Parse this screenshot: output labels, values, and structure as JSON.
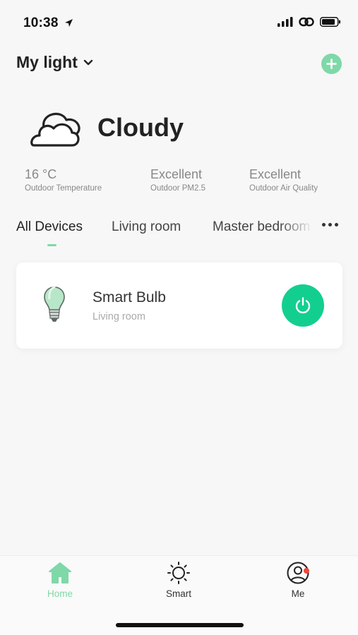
{
  "status_bar": {
    "time": "10:38"
  },
  "header": {
    "home_name": "My light"
  },
  "weather": {
    "condition": "Cloudy",
    "metrics": [
      {
        "value": "16 °C",
        "label": "Outdoor Temperature"
      },
      {
        "value": "Excellent",
        "label": "Outdoor PM2.5"
      },
      {
        "value": "Excellent",
        "label": "Outdoor Air Quality"
      }
    ]
  },
  "tabs": [
    {
      "label": "All Devices",
      "active": true
    },
    {
      "label": "Living room",
      "active": false
    },
    {
      "label": "Master bedroom",
      "active": false
    }
  ],
  "devices": [
    {
      "name": "Smart Bulb",
      "room": "Living room",
      "power": "on"
    }
  ],
  "bottom_nav": [
    {
      "label": "Home",
      "icon": "home-icon",
      "active": true
    },
    {
      "label": "Smart",
      "icon": "sun-icon",
      "active": false
    },
    {
      "label": "Me",
      "icon": "user-icon",
      "active": false,
      "has_notification": true
    }
  ],
  "colors": {
    "accent": "#7fd8a8",
    "power_on": "#13cf8f",
    "notification": "#f0473c",
    "background": "#f7f7f7"
  }
}
